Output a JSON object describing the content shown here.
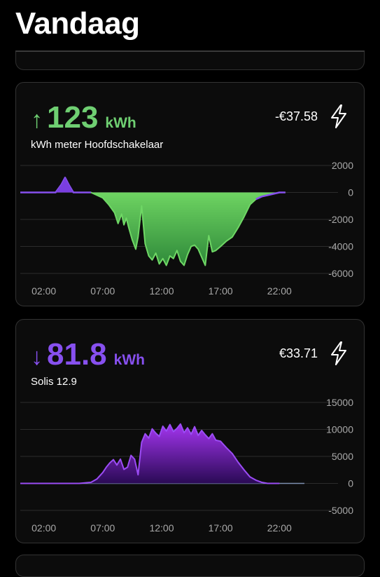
{
  "header": {
    "title": "Vandaag"
  },
  "cards": [
    {
      "arrow": "↑",
      "value": "123",
      "unit": "kWh",
      "device": "kWh meter Hoofdschakelaar",
      "cost": "-€37.58",
      "icon": "lightning-icon",
      "accent": "#6fcf72"
    },
    {
      "arrow": "↓",
      "value": "81.8",
      "unit": "kWh",
      "device": "Solis 12.9",
      "cost": "€33.71",
      "icon": "lightning-icon",
      "accent": "#8750ef"
    }
  ],
  "chart_data": [
    {
      "type": "area",
      "x_tick_labels": [
        "02:00",
        "07:00",
        "12:00",
        "17:00",
        "22:00"
      ],
      "y_tick_labels": [
        "2000",
        "0",
        "-2000",
        "-4000",
        "-6000"
      ],
      "ylim": [
        -6000,
        2000
      ],
      "xlim": [
        0,
        24
      ],
      "grid": true,
      "series_colors": {
        "positive": "#8750ef",
        "negative": "#6fcf72"
      },
      "x": [
        0,
        3.0,
        3.5,
        3.8,
        4.1,
        4.5,
        5.0,
        6.0,
        6.5,
        7.0,
        7.5,
        8.0,
        8.3,
        8.6,
        8.8,
        9.0,
        9.2,
        9.5,
        9.8,
        10.0,
        10.3,
        10.6,
        10.9,
        11.2,
        11.5,
        11.8,
        12.1,
        12.4,
        12.7,
        13.0,
        13.3,
        13.6,
        13.9,
        14.2,
        14.5,
        14.8,
        15.1,
        15.4,
        15.7,
        16.0,
        16.3,
        16.6,
        17.0,
        17.5,
        18.0,
        18.5,
        19.0,
        19.5,
        20.0,
        20.5,
        21.0,
        22.0,
        22.5
      ],
      "values": [
        0,
        0,
        600,
        1100,
        600,
        0,
        0,
        0,
        -200,
        -400,
        -900,
        -1500,
        -2300,
        -1600,
        -2400,
        -1900,
        -2600,
        -3500,
        -4200,
        -3300,
        -1000,
        -3800,
        -4700,
        -5000,
        -4500,
        -5300,
        -4900,
        -5400,
        -4700,
        -4900,
        -4300,
        -5100,
        -5400,
        -4600,
        -4000,
        -3900,
        -4200,
        -4800,
        -5400,
        -3200,
        -4400,
        -4300,
        -4000,
        -3600,
        -3300,
        -2600,
        -1800,
        -900,
        -500,
        -300,
        -200,
        0,
        0
      ]
    },
    {
      "type": "area",
      "x_tick_labels": [
        "02:00",
        "07:00",
        "12:00",
        "17:00",
        "22:00"
      ],
      "y_tick_labels": [
        "15000",
        "10000",
        "5000",
        "0",
        "-5000"
      ],
      "ylim": [
        -5000,
        15000
      ],
      "xlim": [
        0,
        24
      ],
      "grid": true,
      "series_colors": {
        "fill": "#7a28d6",
        "line": "#8750ef"
      },
      "x": [
        0,
        5.0,
        6.0,
        6.5,
        7.0,
        7.3,
        7.6,
        7.9,
        8.2,
        8.5,
        8.8,
        9.1,
        9.4,
        9.7,
        10.0,
        10.3,
        10.6,
        10.9,
        11.2,
        11.5,
        11.8,
        12.1,
        12.4,
        12.7,
        13.0,
        13.3,
        13.6,
        13.9,
        14.2,
        14.5,
        14.8,
        15.1,
        15.4,
        15.7,
        16.0,
        16.3,
        16.6,
        17.0,
        17.5,
        18.0,
        18.5,
        19.0,
        19.5,
        20.0,
        20.5,
        21.0,
        22.0
      ],
      "values": [
        0,
        0,
        200,
        800,
        2000,
        3000,
        3800,
        4400,
        3400,
        4500,
        2600,
        3000,
        5200,
        4500,
        1600,
        7600,
        9200,
        8400,
        10100,
        9300,
        8700,
        10600,
        9700,
        10900,
        9600,
        10200,
        11000,
        9400,
        10300,
        9100,
        10500,
        8900,
        9800,
        9000,
        8300,
        9200,
        8000,
        7800,
        6600,
        5500,
        3900,
        2500,
        1200,
        600,
        200,
        0,
        0
      ]
    }
  ]
}
